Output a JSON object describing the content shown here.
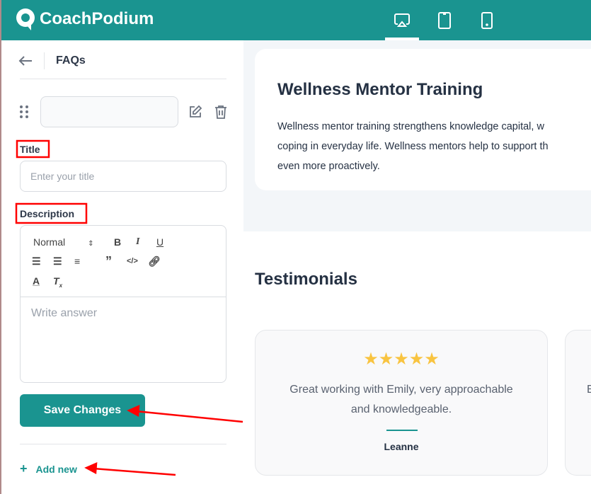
{
  "app": {
    "brand": "CoachPodium",
    "brand_color": "#1a9490"
  },
  "topbar": {
    "devices": [
      {
        "icon": "desktop-icon",
        "active": true
      },
      {
        "icon": "tablet-icon",
        "active": false
      },
      {
        "icon": "mobile-icon",
        "active": false
      }
    ]
  },
  "sidebar": {
    "title": "FAQs",
    "title_label": "Title",
    "title_placeholder": "Enter your title",
    "description_label": "Description",
    "editor": {
      "format": "Normal",
      "placeholder": "Write answer"
    },
    "save_label": "Save Changes",
    "add_label": "Add new",
    "add_icon": "+"
  },
  "preview": {
    "heading": "Wellness Mentor Training",
    "body_lines": [
      "Wellness mentor training strengthens knowledge capital, w",
      "coping in everyday life. Wellness mentors help to support th",
      "even more proactively."
    ],
    "testimonials_heading": "Testimonials",
    "testimonials": [
      {
        "stars": "★★★★★",
        "rating": 5,
        "text_lines": [
          "Great working with Emily, very approachable",
          "and knowledgeable."
        ],
        "name": "Leanne"
      },
      {
        "partial": "E"
      }
    ]
  },
  "annotation_color": "#ff0000"
}
